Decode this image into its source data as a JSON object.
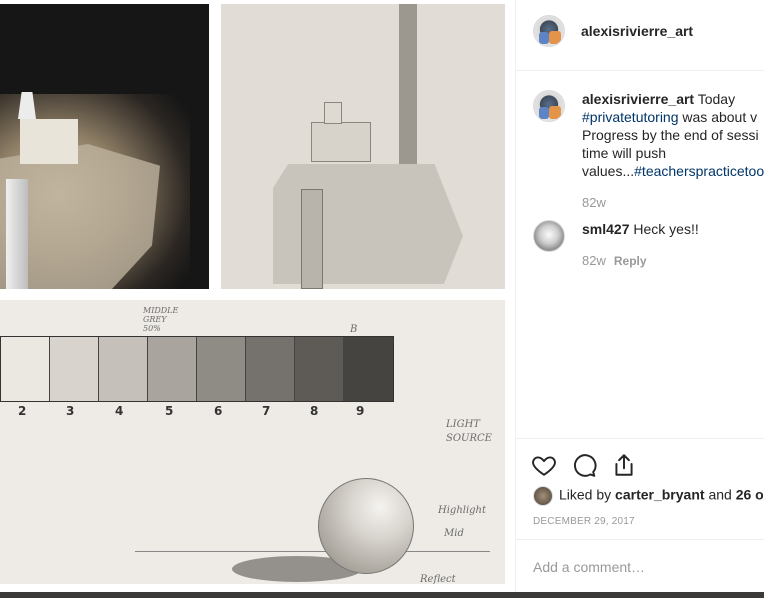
{
  "header": {
    "username": "alexisrivierre_art"
  },
  "caption": {
    "username": "alexisrivierre_art",
    "text_1": "Today",
    "hashtag_1": "#privatetutoring",
    "text_2": "was about v",
    "line_2": "Progress by the end of sessi",
    "line_3": "time will push",
    "text_4": "values...",
    "hashtag_2": "#teacherspracticetoo",
    "age": "82w"
  },
  "comments": [
    {
      "username": "sml427",
      "text": "Heck yes!!",
      "age": "82w",
      "reply_label": "Reply"
    }
  ],
  "likes": {
    "prefix": "Liked by",
    "user": "carter_bryant",
    "middle": "and",
    "count": "26 o"
  },
  "date": "DECEMBER 29, 2017",
  "add_comment_placeholder": "Add a comment…",
  "sketch_labels": {
    "middle_grey": "MIDDLE GREY 50%",
    "b": "B",
    "light_source": "LIGHT SOURCE",
    "highlight": "Highlight",
    "mid": "Mid",
    "reflect": "Reflect"
  },
  "scale_numbers": [
    "2",
    "3",
    "4",
    "5",
    "6",
    "7",
    "8",
    "9"
  ],
  "icons": [
    "heart-icon",
    "comment-icon",
    "share-icon"
  ]
}
